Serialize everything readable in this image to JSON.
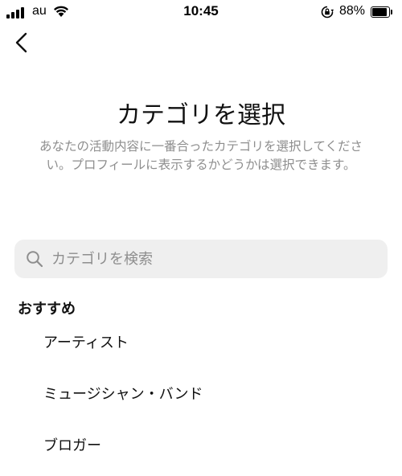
{
  "status_bar": {
    "carrier": "au",
    "time": "10:45",
    "battery_percent": "88%",
    "battery_level": 0.88
  },
  "page": {
    "title": "カテゴリを選択",
    "description": "あなたの活動内容に一番合ったカテゴリを選択してください。プロフィールに表示するかどうかは選択できます。"
  },
  "search": {
    "placeholder": "カテゴリを検索",
    "value": ""
  },
  "recommended": {
    "header": "おすすめ",
    "items": [
      {
        "label": "アーティスト"
      },
      {
        "label": "ミュージシャン・バンド"
      },
      {
        "label": "ブロガー"
      }
    ]
  },
  "icons": {
    "back": "chevron-left-icon",
    "search": "search-icon",
    "wifi": "wifi-icon",
    "signal": "signal-icon",
    "orientation_lock": "orientation-lock-icon",
    "battery": "battery-icon"
  }
}
